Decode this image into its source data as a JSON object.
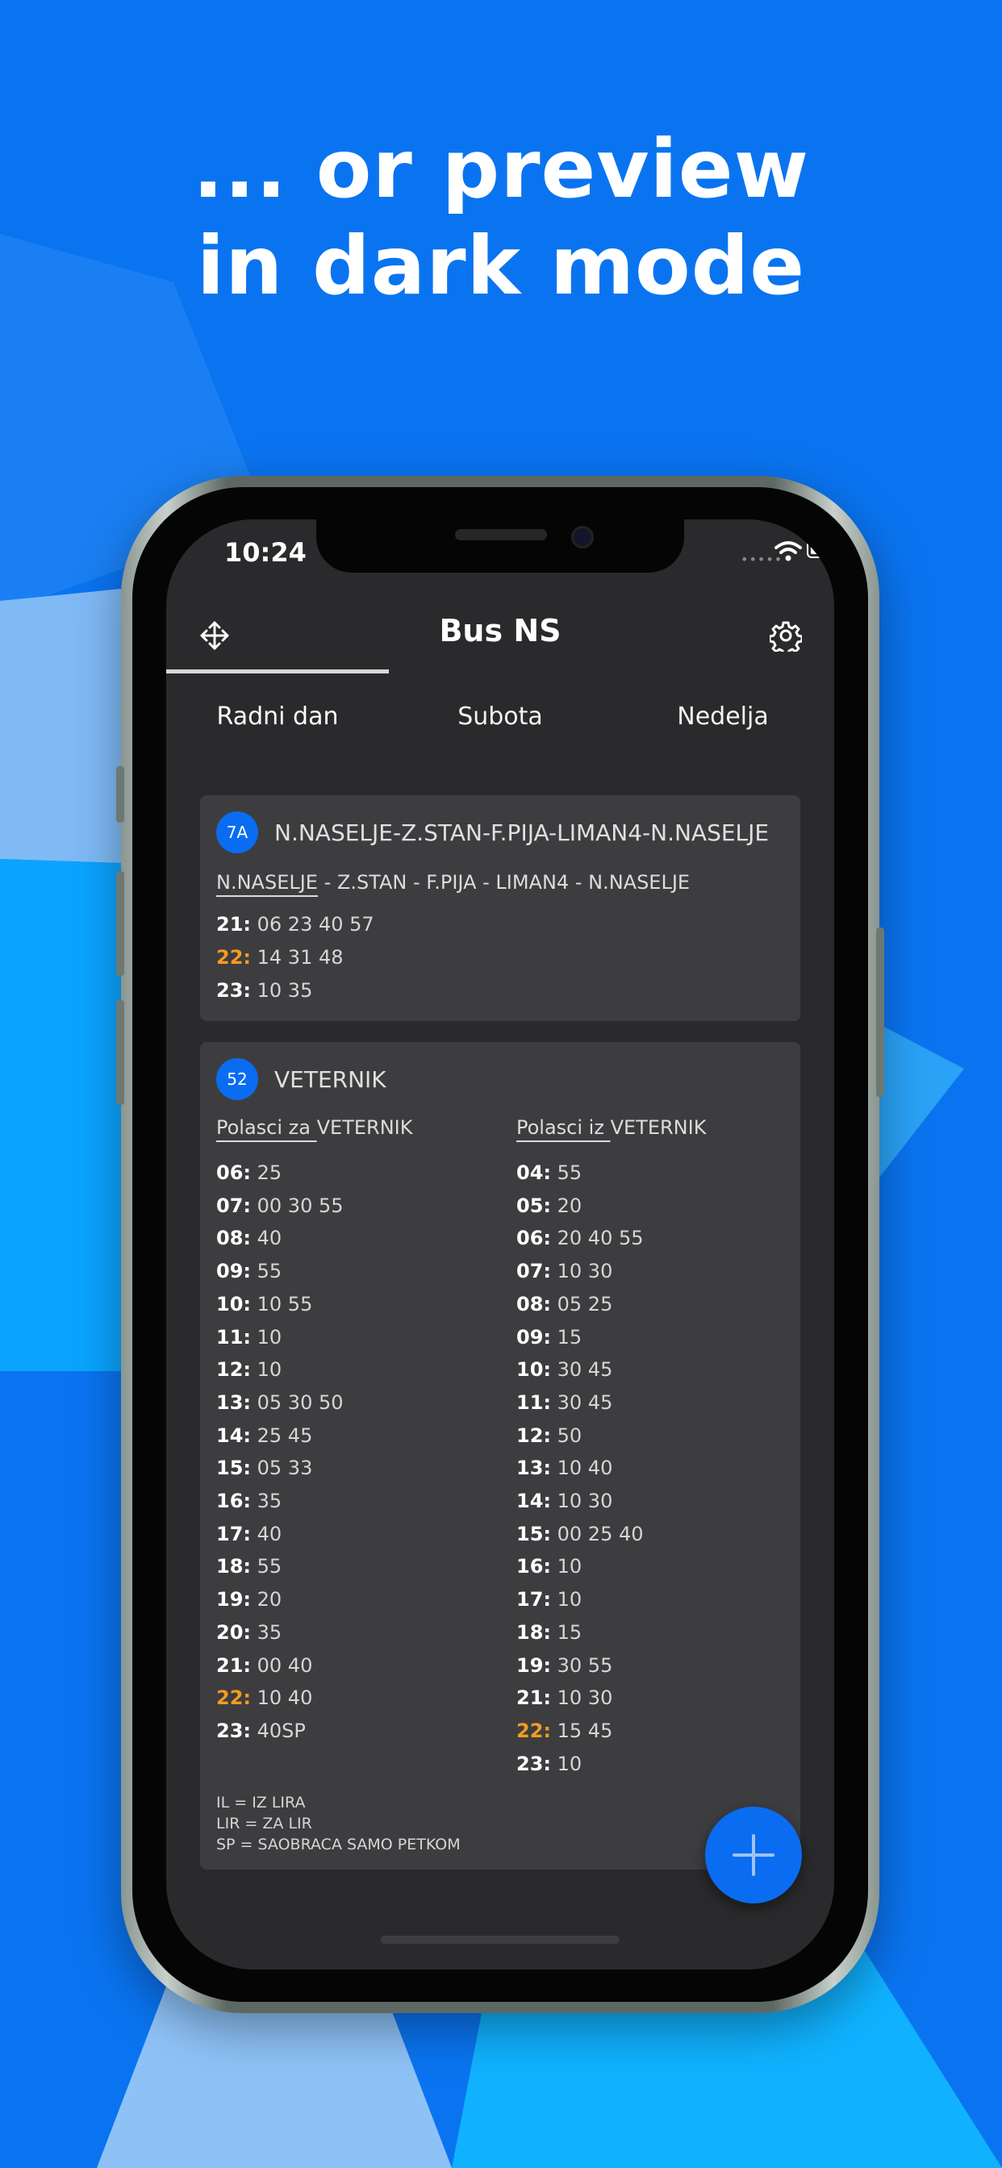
{
  "headline": [
    "... or preview",
    "in dark mode"
  ],
  "status": {
    "time": "10:24",
    "signal": "•••••"
  },
  "app": {
    "title": "Bus NS"
  },
  "tabs": [
    "Radni dan",
    "Subota",
    "Nedelja"
  ],
  "active_tab": 0,
  "cards": [
    {
      "badge": "7A",
      "title": "N.NASELJE-Z.STAN-F.PIJA-LIMAN4-N.NASELJE",
      "route_first": "N.NASELJE",
      "route_rest": " - Z.STAN - F.PIJA - LIMAN4 - N.NASELJE",
      "departures": [
        {
          "hour": "21:",
          "mins": "06 23 40 57",
          "highlight": false
        },
        {
          "hour": "22:",
          "mins": "14 31 48",
          "highlight": true
        },
        {
          "hour": "23:",
          "mins": "10 35",
          "highlight": false
        }
      ]
    },
    {
      "badge": "52",
      "title": "VETERNIK",
      "col1_prefix": "Polasci za ",
      "col1_dest": " VETERNIK",
      "col2_prefix": "Polasci iz ",
      "col2_dest": " VETERNIK",
      "col1": [
        {
          "hour": "06:",
          "mins": "25",
          "highlight": false
        },
        {
          "hour": "07:",
          "mins": "00 30 55",
          "highlight": false
        },
        {
          "hour": "08:",
          "mins": "40",
          "highlight": false
        },
        {
          "hour": "09:",
          "mins": "55",
          "highlight": false
        },
        {
          "hour": "10:",
          "mins": "10 55",
          "highlight": false
        },
        {
          "hour": "11:",
          "mins": "10",
          "highlight": false
        },
        {
          "hour": "12:",
          "mins": "10",
          "highlight": false
        },
        {
          "hour": "13:",
          "mins": "05 30 50",
          "highlight": false
        },
        {
          "hour": "14:",
          "mins": "25 45",
          "highlight": false
        },
        {
          "hour": "15:",
          "mins": "05 33",
          "highlight": false
        },
        {
          "hour": "16:",
          "mins": "35",
          "highlight": false
        },
        {
          "hour": "17:",
          "mins": "40",
          "highlight": false
        },
        {
          "hour": "18:",
          "mins": "55",
          "highlight": false
        },
        {
          "hour": "19:",
          "mins": "20",
          "highlight": false
        },
        {
          "hour": "20:",
          "mins": "35",
          "highlight": false
        },
        {
          "hour": "21:",
          "mins": "00 40",
          "highlight": false
        },
        {
          "hour": "22:",
          "mins": "10 40",
          "highlight": true
        },
        {
          "hour": "23:",
          "mins": "40SP",
          "highlight": false
        }
      ],
      "col2": [
        {
          "hour": "04:",
          "mins": "55",
          "highlight": false
        },
        {
          "hour": "05:",
          "mins": "20",
          "highlight": false
        },
        {
          "hour": "06:",
          "mins": "20 40 55",
          "highlight": false
        },
        {
          "hour": "07:",
          "mins": "10 30",
          "highlight": false
        },
        {
          "hour": "08:",
          "mins": "05 25",
          "highlight": false
        },
        {
          "hour": "09:",
          "mins": "15",
          "highlight": false
        },
        {
          "hour": "10:",
          "mins": "30 45",
          "highlight": false
        },
        {
          "hour": "11:",
          "mins": "30 45",
          "highlight": false
        },
        {
          "hour": "12:",
          "mins": "50",
          "highlight": false
        },
        {
          "hour": "13:",
          "mins": "10 40",
          "highlight": false
        },
        {
          "hour": "14:",
          "mins": "10 30",
          "highlight": false
        },
        {
          "hour": "15:",
          "mins": "00 25 40",
          "highlight": false
        },
        {
          "hour": "16:",
          "mins": "10",
          "highlight": false
        },
        {
          "hour": "17:",
          "mins": "10",
          "highlight": false
        },
        {
          "hour": "18:",
          "mins": "15",
          "highlight": false
        },
        {
          "hour": "19:",
          "mins": "30 55",
          "highlight": false
        },
        {
          "hour": "21:",
          "mins": "10 30",
          "highlight": false
        },
        {
          "hour": "22:",
          "mins": "15 45",
          "highlight": true
        },
        {
          "hour": "23:",
          "mins": "10",
          "highlight": false
        }
      ],
      "legend": [
        "IL = IZ LIRA",
        "LIR = ZA LIR",
        "SP = SAOBRACA SAMO PETKOM"
      ]
    }
  ],
  "colors": {
    "brand_blue": "#0a74f0",
    "highlight": "#f39c1f",
    "card": "#3d3d40",
    "screen": "#2a2a2c"
  },
  "icons": {
    "move": "move-arrows-icon",
    "settings": "gear-icon",
    "fab": "plus-icon"
  }
}
